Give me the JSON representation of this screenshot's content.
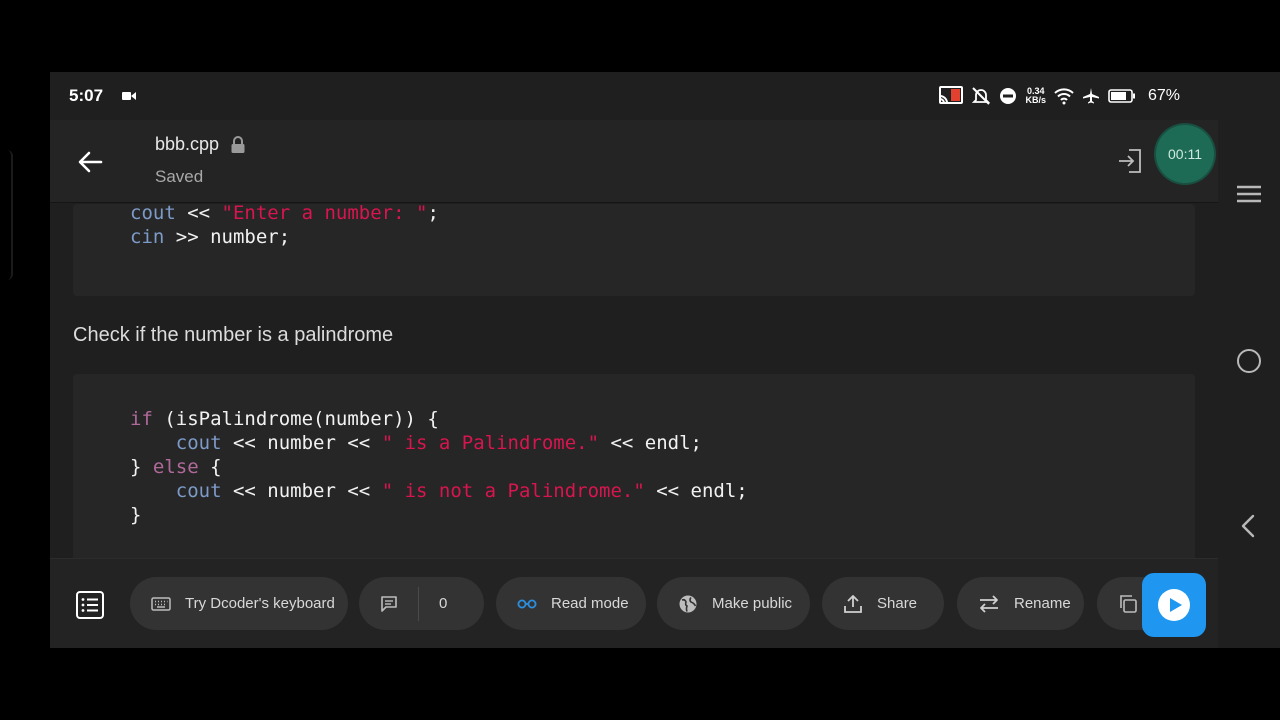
{
  "status_bar": {
    "time": "5:07",
    "net_speed_value": "0.34",
    "net_speed_unit": "KB/s",
    "battery": "67%",
    "icons": [
      "video-record-icon",
      "cast-icon",
      "bell-off-icon",
      "do-not-disturb-icon",
      "wifi-icon",
      "airplane-icon",
      "battery-icon"
    ]
  },
  "app_bar": {
    "file_name": "bbb.cpp",
    "save_status": "Saved",
    "timer": "00:11"
  },
  "code_block_1": {
    "line1": {
      "id": "cout",
      "op": " << ",
      "str": "\"Enter a number: \"",
      "end": ";"
    },
    "line2": {
      "id": "cin",
      "rest": " >> number;"
    }
  },
  "prose": "Check if the number is a palindrome",
  "code_block_2": {
    "line1": {
      "kw": "if",
      "rest": " (isPalindrome(number)) {"
    },
    "line2": {
      "indent": "    ",
      "id": "cout",
      "mid": " << number << ",
      "str": "\" is a Palindrome.\"",
      "end": " << endl;"
    },
    "line3": {
      "brace": "} ",
      "kw": "else",
      "rest": " {"
    },
    "line4": {
      "indent": "    ",
      "id": "cout",
      "mid": " << number << ",
      "str": "\" is not a Palindrome.\"",
      "end": " << endl;"
    },
    "line5": {
      "brace": "}"
    }
  },
  "toolbar": {
    "keyboard_label": "Try Dcoder's keyboard",
    "comments_count": "0",
    "read_mode_label": "Read mode",
    "make_public_label": "Make public",
    "share_label": "Share",
    "rename_label": "Rename"
  },
  "colors": {
    "accent_run": "#1f97f0",
    "timer_bg": "#1e6b55",
    "string": "#d8154f",
    "keyword": "#b06a9a",
    "identifier": "#7d9bc8"
  }
}
